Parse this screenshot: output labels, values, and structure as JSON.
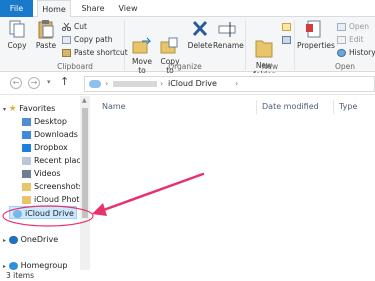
{
  "tabs": {
    "file": "File",
    "home": "Home",
    "share": "Share",
    "view": "View"
  },
  "ribbon": {
    "clipboard": {
      "copy": "Copy",
      "paste": "Paste",
      "cut": "Cut",
      "copy_path": "Copy path",
      "paste_shortcut": "Paste shortcut",
      "label": "Clipboard"
    },
    "organize": {
      "move_to": "Move\nto",
      "copy_to": "Copy\nto",
      "delete": "Delete",
      "rename": "Rename",
      "label": "Organize"
    },
    "new": {
      "new_folder": "New\nfolder",
      "label": "New"
    },
    "open": {
      "properties": "Properties",
      "open": "Open",
      "edit": "Edit",
      "history": "History",
      "label": "Open"
    }
  },
  "address": {
    "nav_back": "←",
    "nav_forward": "→",
    "nav_up": "↑",
    "crumbs": [
      "iCloud Drive"
    ]
  },
  "nav": {
    "favorites": "Favorites",
    "items": [
      "Desktop",
      "Downloads",
      "Dropbox",
      "Recent places",
      "Videos",
      "Screenshots",
      "iCloud Photo",
      "iCloud Drive"
    ],
    "onedrive": "OneDrive",
    "homegroup": "Homegroup"
  },
  "columns": {
    "name": "Name",
    "date_modified": "Date modified",
    "type": "Type"
  },
  "status": {
    "items": "3 items"
  },
  "colors": {
    "accent": "#1979ca",
    "annotation": "#e8336a"
  }
}
